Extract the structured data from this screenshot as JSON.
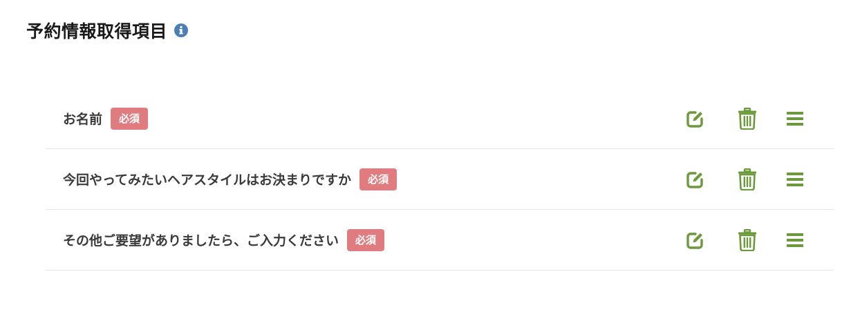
{
  "page": {
    "title": "予約情報取得項目",
    "info_icon": "info-circle-icon"
  },
  "colors": {
    "accent_green": "#6a9a3c",
    "required_badge": "#e07b80",
    "info_blue": "#4a7eb5"
  },
  "fields": [
    {
      "label": "お名前",
      "badge": "必須"
    },
    {
      "label": "今回やってみたいヘアスタイルはお決まりですか",
      "badge": "必須"
    },
    {
      "label": "その他ご要望がありましたら、ご入力ください",
      "badge": "必須"
    }
  ],
  "row_actions": [
    "edit-icon",
    "trash-icon",
    "drag-handle-icon"
  ]
}
